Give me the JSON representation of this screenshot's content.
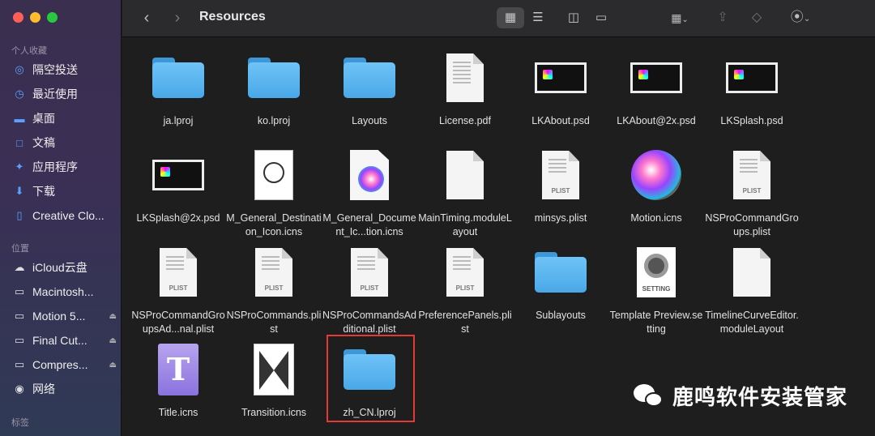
{
  "window": {
    "title": "Resources"
  },
  "sidebar": {
    "favorites_header": "个人收藏",
    "favorites": [
      {
        "label": "隔空投送",
        "icon": "airdrop-icon"
      },
      {
        "label": "最近使用",
        "icon": "clock-icon"
      },
      {
        "label": "桌面",
        "icon": "desktop-icon"
      },
      {
        "label": "文稿",
        "icon": "document-icon"
      },
      {
        "label": "应用程序",
        "icon": "applications-icon"
      },
      {
        "label": "下载",
        "icon": "download-icon"
      },
      {
        "label": "Creative Clo...",
        "icon": "file-icon"
      }
    ],
    "locations_header": "位置",
    "locations": [
      {
        "label": "iCloud云盘",
        "icon": "cloud-icon"
      },
      {
        "label": "Macintosh...",
        "icon": "disk-icon"
      },
      {
        "label": "Motion 5...",
        "icon": "disk-icon",
        "eject": true
      },
      {
        "label": "Final Cut...",
        "icon": "disk-icon",
        "eject": true
      },
      {
        "label": "Compres...",
        "icon": "disk-icon",
        "eject": true
      },
      {
        "label": "网络",
        "icon": "network-icon"
      }
    ],
    "tags_header": "标签"
  },
  "toolbar": {
    "back_icon": "chevron-left-icon",
    "forward_icon": "chevron-right-icon",
    "view_modes": [
      "icon-view-icon",
      "list-view-icon",
      "column-view-icon",
      "gallery-view-icon"
    ],
    "active_view": "icon-view-icon"
  },
  "files": [
    {
      "name": "ja.lproj",
      "type": "folder"
    },
    {
      "name": "ko.lproj",
      "type": "folder"
    },
    {
      "name": "Layouts",
      "type": "folder"
    },
    {
      "name": "License.pdf",
      "type": "pdf"
    },
    {
      "name": "LKAbout.psd",
      "type": "psd"
    },
    {
      "name": "LKAbout@2x.psd",
      "type": "psd"
    },
    {
      "name": "LKSplash.psd",
      "type": "psd"
    },
    {
      "name": "LKSplash@2x.psd",
      "type": "psd"
    },
    {
      "name": "M_General_Destination_Icon.icns",
      "type": "dest"
    },
    {
      "name": "M_General_Docume...ment_Ic...tion.icns",
      "display": "M_General_Document_Ic...tion.icns",
      "type": "docicn"
    },
    {
      "name": "MainTiming.moduleLayout",
      "type": "doc"
    },
    {
      "name": "minsys.plist",
      "type": "plist",
      "tag": "PLIST"
    },
    {
      "name": "Motion.icns",
      "type": "motion"
    },
    {
      "name": "NSProCommandGroups.plist",
      "type": "plist",
      "tag": "PLIST"
    },
    {
      "name": "NSProCommandGroupsAd...nal.plist",
      "type": "plist",
      "tag": "PLIST"
    },
    {
      "name": "NSProCommands.plist",
      "type": "plist",
      "tag": "PLIST"
    },
    {
      "name": "NSProCommandsAdditional.plist",
      "type": "plist",
      "tag": "PLIST"
    },
    {
      "name": "PreferencePanels.plist",
      "type": "plist",
      "tag": "PLIST"
    },
    {
      "name": "Sublayouts",
      "type": "folder"
    },
    {
      "name": "Template Preview.setting",
      "type": "setting",
      "tag": "SETTING"
    },
    {
      "name": "TimelineCurveEditor.moduleLayout",
      "type": "doc"
    },
    {
      "name": "Title.icns",
      "type": "title",
      "glyph": "T"
    },
    {
      "name": "Transition.icns",
      "type": "transition"
    },
    {
      "name": "zh_CN.lproj",
      "type": "folder",
      "highlighted": true
    }
  ],
  "watermark": {
    "text": "鹿鸣软件安装管家"
  }
}
